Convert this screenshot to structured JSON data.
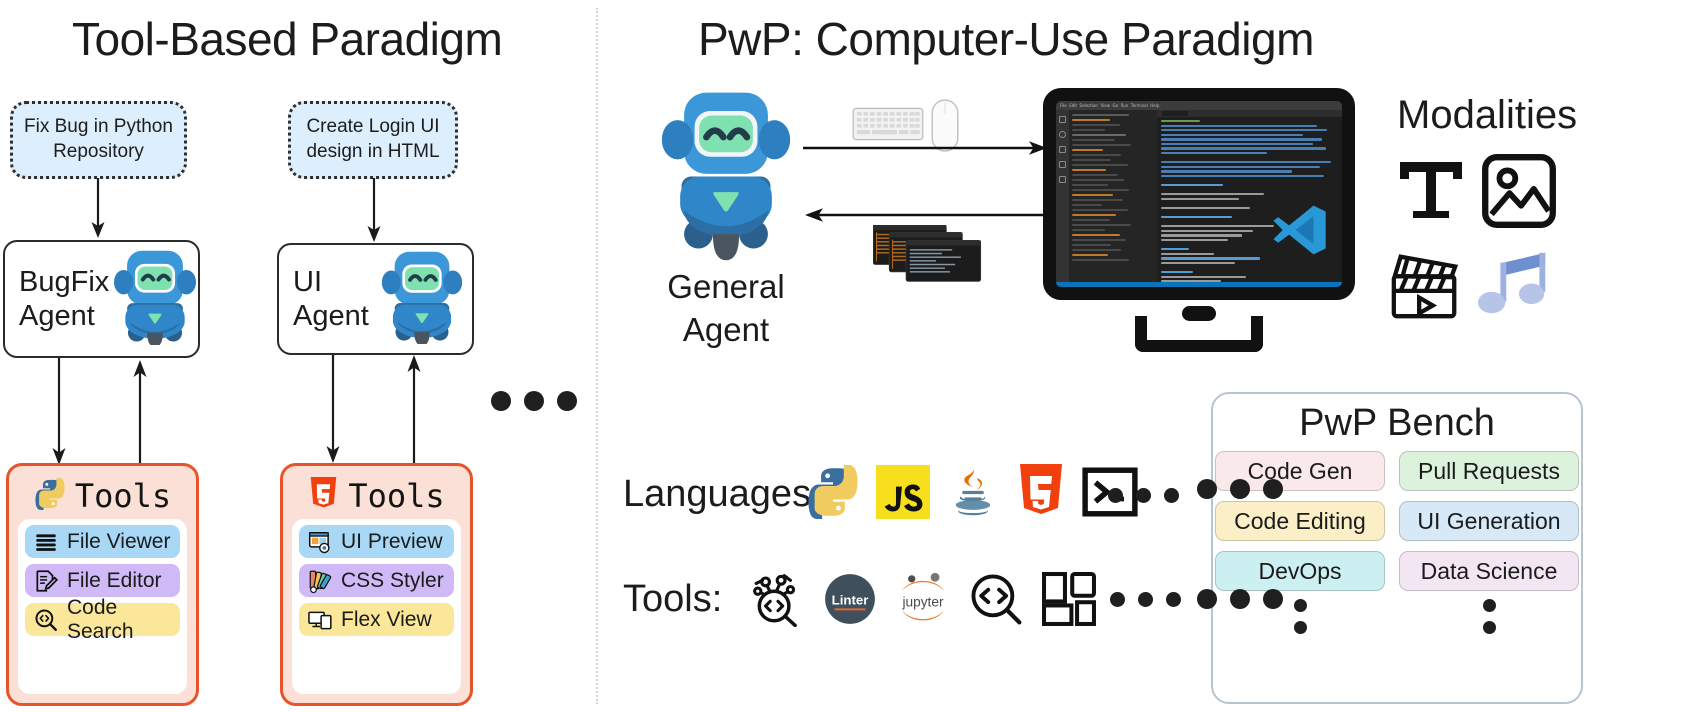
{
  "left_panel": {
    "title": "Tool-Based Paradigm",
    "tasks": [
      {
        "text": "Fix Bug in Python Repository"
      },
      {
        "text": "Create Login UI design in HTML"
      }
    ],
    "agents": [
      {
        "label": "BugFix\nAgent",
        "icon": "robot-icon"
      },
      {
        "label": "UI\nAgent",
        "icon": "robot-icon"
      }
    ],
    "tool_panels": [
      {
        "header": "Tools",
        "header_icon": "python-icon",
        "items": [
          {
            "label": "File Viewer",
            "icon": "list-lines-icon",
            "color": "#a8d8f5"
          },
          {
            "label": "File Editor",
            "icon": "document-pencil-icon",
            "color": "#cfb9f7"
          },
          {
            "label": "Code Search",
            "icon": "code-magnifier-icon",
            "color": "#fae79a"
          }
        ]
      },
      {
        "header": "Tools",
        "header_icon": "html5-icon",
        "items": [
          {
            "label": "UI Preview",
            "icon": "browser-eye-icon",
            "color": "#a8d8f5"
          },
          {
            "label": "CSS Styler",
            "icon": "color-palette-icon",
            "color": "#cfb9f7"
          },
          {
            "label": "Flex View",
            "icon": "responsive-screens-icon",
            "color": "#fae79a"
          }
        ]
      }
    ],
    "more_indicator": "•••"
  },
  "right_panel": {
    "title": "PwP: Computer-Use Paradigm",
    "agent": {
      "label": "General\nAgent",
      "icon": "robot-icon"
    },
    "input_devices": [
      "keyboard-icon",
      "mouse-icon"
    ],
    "output_stack": "terminal-windows-icon",
    "computer": {
      "icon": "desktop-monitor-icon",
      "app_logo": "vscode-icon"
    },
    "modalities": {
      "label": "Modalities",
      "items": [
        "text-icon",
        "image-icon",
        "video-icon",
        "audio-icon"
      ]
    },
    "languages": {
      "label": "Languages:",
      "items": [
        "python-icon",
        "javascript-icon",
        "java-icon",
        "html5-icon",
        "terminal-icon"
      ],
      "more": "•••"
    },
    "tools": {
      "label": "Tools:",
      "items": [
        "debugger-icon",
        "linter-icon",
        "jupyter-icon",
        "code-search-icon",
        "components-icon"
      ],
      "more": "•••"
    },
    "bench": {
      "title": "PwP Bench",
      "chips": [
        {
          "label": "Code Gen",
          "color": "#fae9ea"
        },
        {
          "label": "Pull Requests",
          "color": "#ddf2dd"
        },
        {
          "label": "Code Editing",
          "color": "#fbefc8"
        },
        {
          "label": "UI Generation",
          "color": "#d7e8f7"
        },
        {
          "label": "DevOps",
          "color": "#ccf0f2"
        },
        {
          "label": "Data Science",
          "color": "#f3e6f3"
        }
      ],
      "continuation": "⋮"
    }
  },
  "accents": {
    "tool_panel_border": "#e8542a",
    "tool_panel_bg": "#fae0d7",
    "task_bubble_bg": "#ddeefc",
    "robot_blue": "#3b97d8",
    "robot_face": "#7fe0b0"
  }
}
